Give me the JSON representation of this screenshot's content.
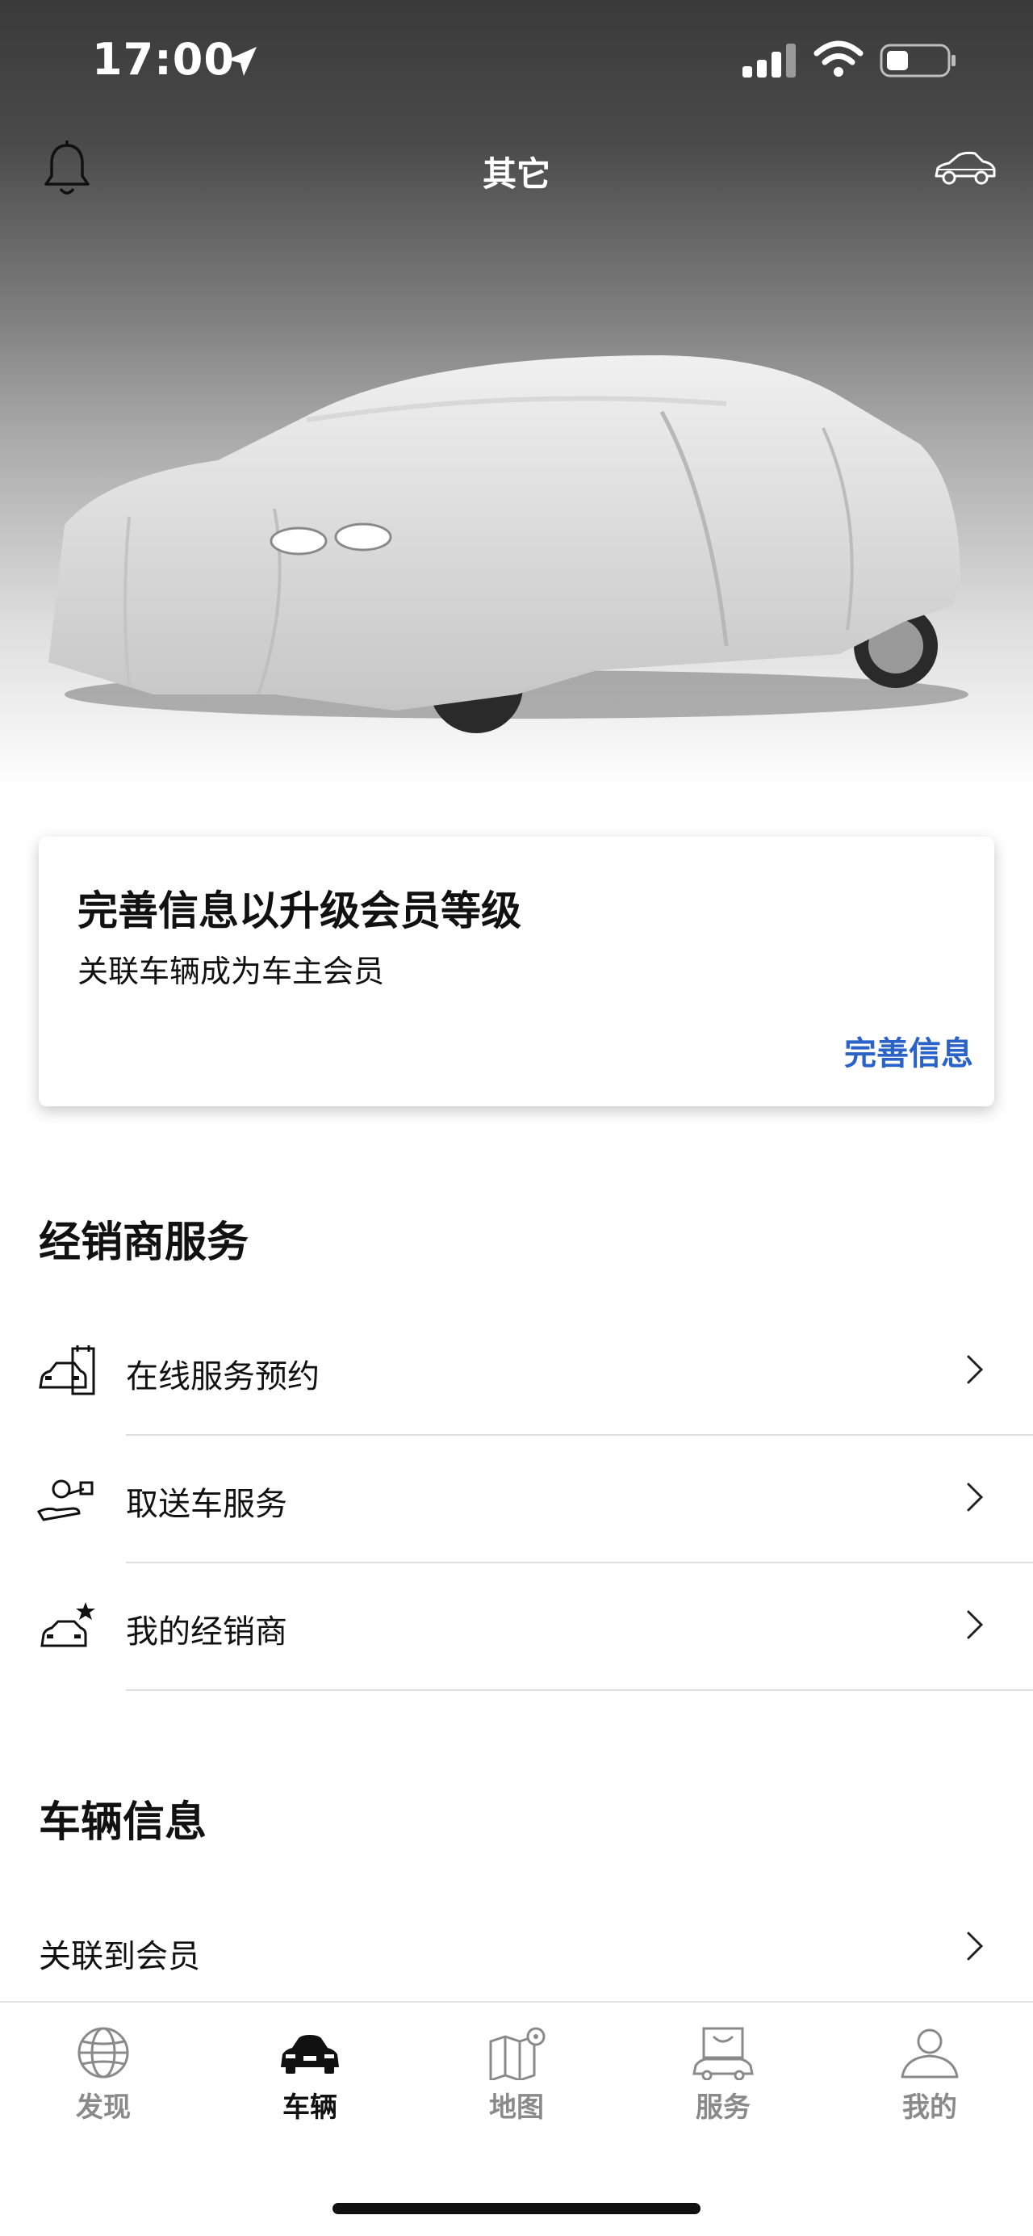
{
  "status_bar": {
    "time": "17:00"
  },
  "header": {
    "title": "其它"
  },
  "card": {
    "title": "完善信息以升级会员等级",
    "subtitle": "关联车辆成为车主会员",
    "link": "完善信息",
    "link_color": "#2a62c8"
  },
  "dealer_section": {
    "title": "经销商服务",
    "items": [
      {
        "label": "在线服务预约",
        "icon": "car-calendar-icon"
      },
      {
        "label": "取送车服务",
        "icon": "key-handover-icon"
      },
      {
        "label": "我的经销商",
        "icon": "car-star-icon"
      }
    ]
  },
  "vehicle_section": {
    "title": "车辆信息",
    "items": [
      {
        "label": "关联到会员"
      }
    ]
  },
  "tabs": [
    {
      "label": "发现",
      "icon": "globe-icon",
      "active": false
    },
    {
      "label": "车辆",
      "icon": "car-icon",
      "active": true
    },
    {
      "label": "地图",
      "icon": "map-icon",
      "active": false
    },
    {
      "label": "服务",
      "icon": "shopping-bag-icon",
      "active": false
    },
    {
      "label": "我的",
      "icon": "person-icon",
      "active": false
    }
  ]
}
